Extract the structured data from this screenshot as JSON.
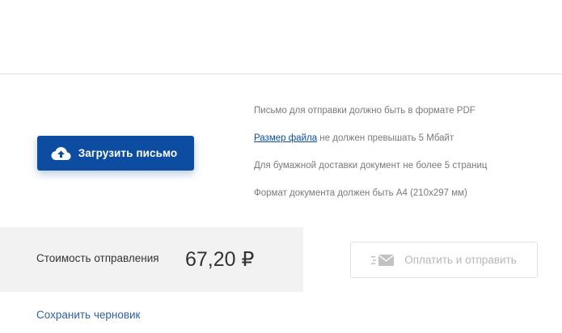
{
  "upload": {
    "label": "Загрузить письмо",
    "icon": "cloud-upload-icon"
  },
  "requirements": {
    "format": "Письмо для отправки должно быть в формате PDF",
    "size_link": "Размер файла",
    "size_rest": " не должен превышать 5 Мбайт",
    "pages": "Для бумажной доставки документ не более 5 страниц",
    "paper": "Формат документа должен быть А4 (210х297 мм)"
  },
  "cost": {
    "label": "Стоимость отправления",
    "value": "67,20 ₽"
  },
  "pay": {
    "label": "Оплатить и отправить",
    "icon": "envelope-send-icon",
    "state": "disabled"
  },
  "draft": {
    "label": "Сохранить черновик"
  },
  "colors": {
    "primary": "#0c4da2",
    "link": "#2f5f9e",
    "muted_text": "#7a7a7a",
    "disabled_text": "#b7b7b7",
    "panel_bg": "#f2f2f2"
  }
}
